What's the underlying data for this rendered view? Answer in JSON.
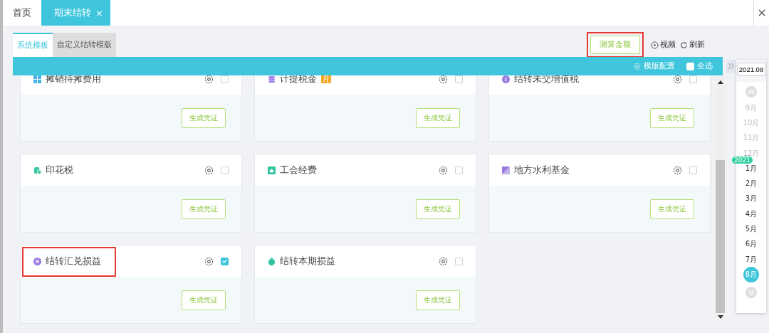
{
  "tabs": [
    {
      "label": "首页",
      "selected": false,
      "closable": false
    },
    {
      "label": "期末结转",
      "selected": true,
      "closable": true,
      "close": "×"
    }
  ],
  "subtabs": [
    {
      "label": "系统模板",
      "selected": true
    },
    {
      "label": "自定义结转模版",
      "selected": false
    }
  ],
  "actions": {
    "measure": {
      "label": "测算金额",
      "highlighted": true
    },
    "video": "视频",
    "refresh": "刷新"
  },
  "toolbar": {
    "config": "模版配置",
    "select_all": {
      "label": "全选",
      "checked": false
    }
  },
  "cards": [
    {
      "title": "摊销待摊费用",
      "kind": "grid",
      "color": "#4ab3e8",
      "checked": false,
      "highlighted": false,
      "button": "生成凭证"
    },
    {
      "title": "计提税金",
      "kind": "coins",
      "color": "#a98be8",
      "badge": "月",
      "checked": false,
      "highlighted": false,
      "button": "生成凭证"
    },
    {
      "title": "结转未交增值税",
      "kind": "circle",
      "color": "#9b7be0",
      "checked": false,
      "highlighted": false,
      "button": "生成凭证"
    },
    {
      "title": "印花税",
      "kind": "stack",
      "color": "#3cc9a5",
      "checked": false,
      "highlighted": false,
      "button": "生成凭证"
    },
    {
      "title": "工会经费",
      "kind": "house",
      "color": "#2fc4a0",
      "checked": false,
      "highlighted": false,
      "button": "生成凭证"
    },
    {
      "title": "地方水利基金",
      "kind": "flag",
      "color": "#9b7be0",
      "checked": false,
      "highlighted": false,
      "button": "生成凭证"
    },
    {
      "title": "结转汇兑损益",
      "kind": "list",
      "color": "#9b7be0",
      "checked": true,
      "highlighted": true,
      "button": "生成凭证"
    },
    {
      "title": "结转本期损益",
      "kind": "bag",
      "color": "#2fc4a0",
      "checked": false,
      "highlighted": false,
      "button": "生成凭证"
    }
  ],
  "calendar": {
    "value": "2021.08",
    "year_tag": "2021",
    "months": [
      {
        "label": "9月",
        "disabled": true,
        "selected": false
      },
      {
        "label": "10月",
        "disabled": true,
        "selected": false
      },
      {
        "label": "11月",
        "disabled": true,
        "selected": false
      },
      {
        "label": "12月",
        "disabled": true,
        "selected": false
      },
      {
        "label": "1月",
        "disabled": false,
        "selected": false,
        "year_start": true
      },
      {
        "label": "2月",
        "disabled": false,
        "selected": false
      },
      {
        "label": "3月",
        "disabled": false,
        "selected": false
      },
      {
        "label": "4月",
        "disabled": false,
        "selected": false
      },
      {
        "label": "5月",
        "disabled": false,
        "selected": false
      },
      {
        "label": "6月",
        "disabled": false,
        "selected": false
      },
      {
        "label": "7月",
        "disabled": false,
        "selected": false
      },
      {
        "label": "8月",
        "disabled": false,
        "selected": true
      }
    ]
  }
}
